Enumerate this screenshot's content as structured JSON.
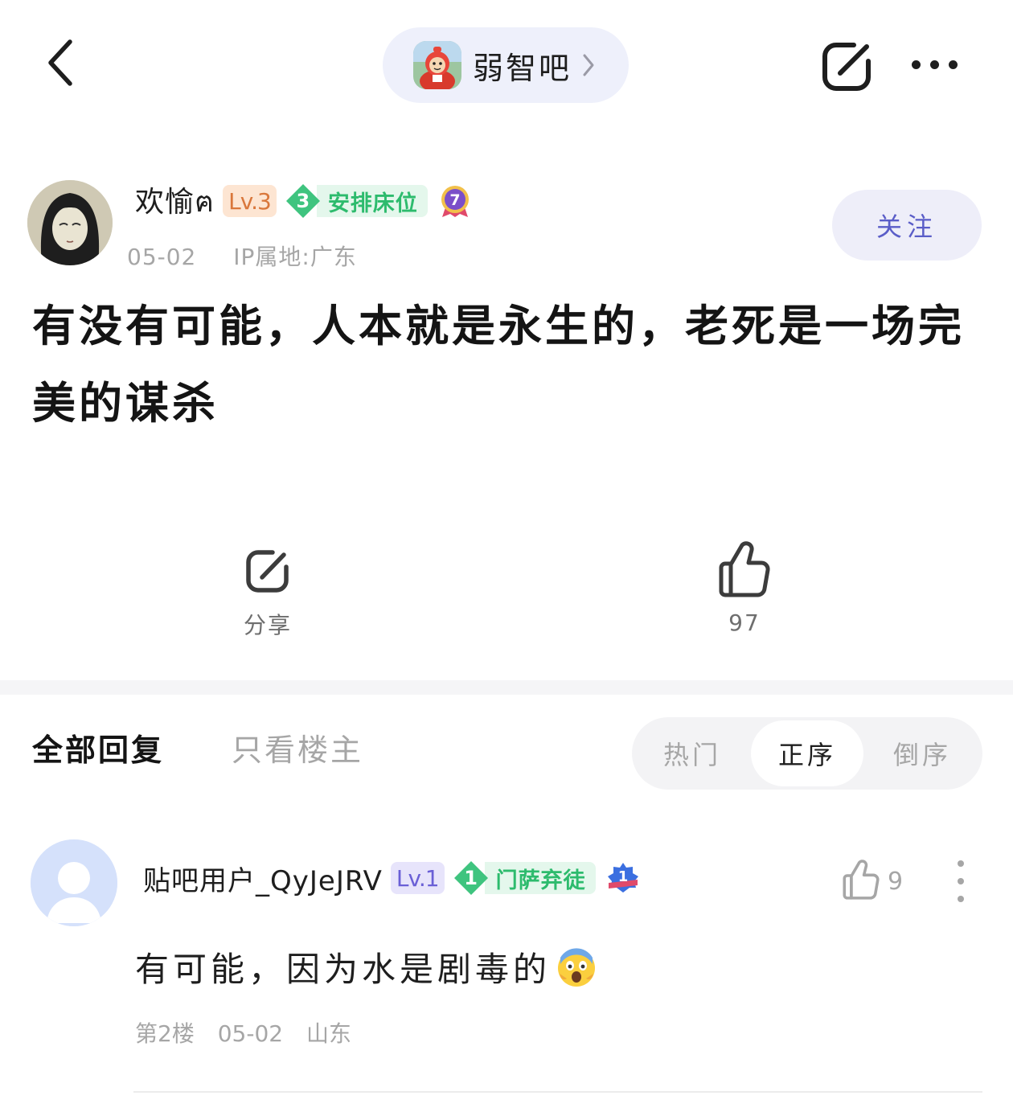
{
  "top_bar": {
    "back_icon": "chevron-left-icon",
    "forum_name": "弱智吧",
    "forum_icon": "teletubby-forum-icon",
    "share_icon": "share-icon",
    "more_icon": "more-horizontal-icon"
  },
  "post": {
    "author": {
      "name": "欢愉ฅ",
      "level": "Lv.3",
      "rank_number": "3",
      "rank_title": "安排床位",
      "medal_number": "7",
      "date": "05-02",
      "ip": "IP属地:广东"
    },
    "follow_label": "关注",
    "title": "有没有可能，人本就是永生的，老死是一场完美的谋杀",
    "share_label": "分享",
    "like_count": "97"
  },
  "replies_header": {
    "tab_all": "全部回复",
    "tab_op_only": "只看楼主",
    "sort_options": [
      "热门",
      "正序",
      "倒序"
    ],
    "selected_sort": "正序"
  },
  "replies": [
    {
      "name": "贴吧用户_QyJeJRV",
      "level": "Lv.1",
      "rank_number": "1",
      "rank_title": "门萨弃徒",
      "medal_number": "1",
      "like_count": "9",
      "text": "有可能，因为水是剧毒的",
      "emoji": "scream-emoji",
      "floor": "第2楼",
      "date": "05-02",
      "location": "山东"
    }
  ],
  "colors": {
    "accent": "#5a5dc8",
    "rank_green": "#2dbb6d",
    "muted": "#a6a6a6"
  }
}
